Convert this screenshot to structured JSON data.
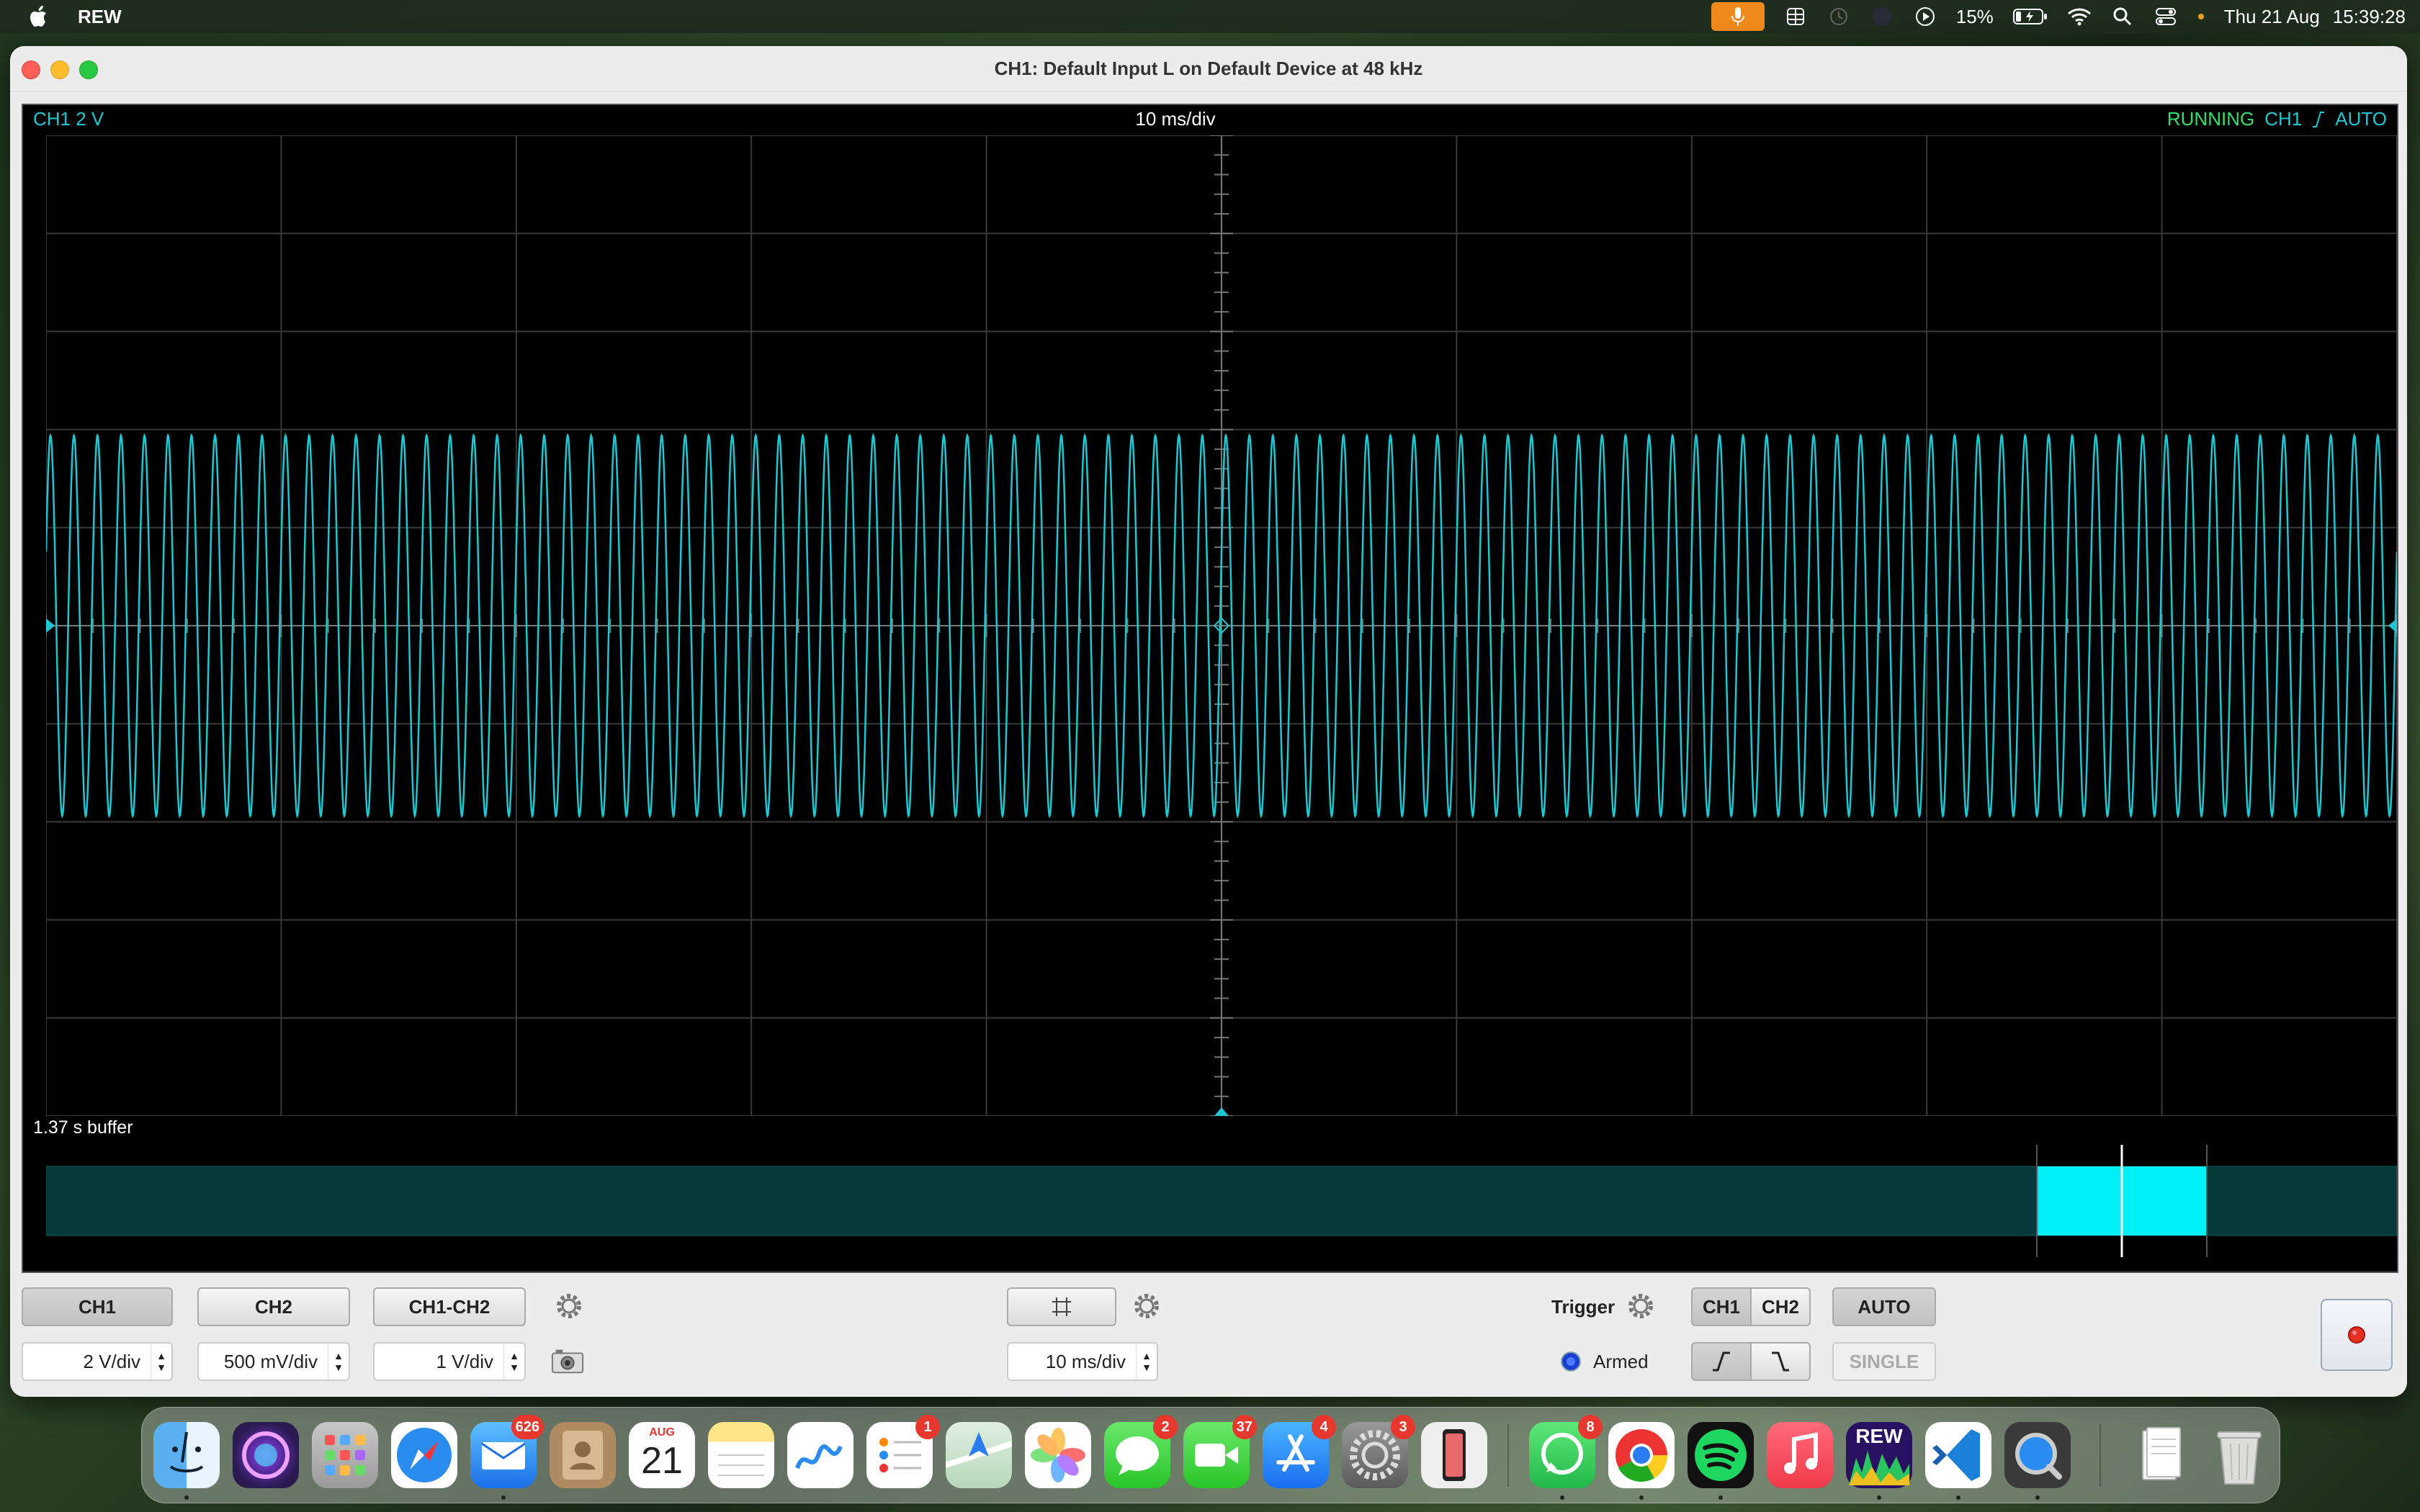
{
  "menubar": {
    "app_name": "REW",
    "battery": "15%",
    "date": "Thu 21 Aug",
    "time": "15:39:28"
  },
  "window": {
    "title": "CH1: Default Input L on Default Device at 48 kHz"
  },
  "scope": {
    "channel_scale": "CH1 2 V",
    "timebase": "10 ms/div",
    "status": "RUNNING",
    "trigger_channel": "CH1",
    "trigger_mode": "AUTO",
    "buffer_label": "1.37 s buffer",
    "trace_color": "#1ec8d2",
    "overview_color": "#063a3a",
    "overview_window_color": "#00f0f8",
    "status_color": "#34e06a"
  },
  "controls": {
    "ch1": "CH1",
    "ch2": "CH2",
    "ch1_minus_ch2": "CH1-CH2",
    "ch1_vdiv": "2 V/div",
    "ch2_vdiv": "500 mV/div",
    "diff_vdiv": "1 V/div",
    "timebase": "10 ms/div",
    "trigger_label": "Trigger",
    "trigger_ch1": "CH1",
    "trigger_ch2": "CH2",
    "auto": "AUTO",
    "single": "SINGLE",
    "armed": "Armed"
  },
  "dock": {
    "badges": {
      "mail": "626",
      "calendar_month": "AUG",
      "calendar_day": "21",
      "reminders": "1",
      "messages": "2",
      "facetime": "37",
      "appstore": "4",
      "settings": "3",
      "whatsapp": "8",
      "rew": "REW"
    }
  }
}
